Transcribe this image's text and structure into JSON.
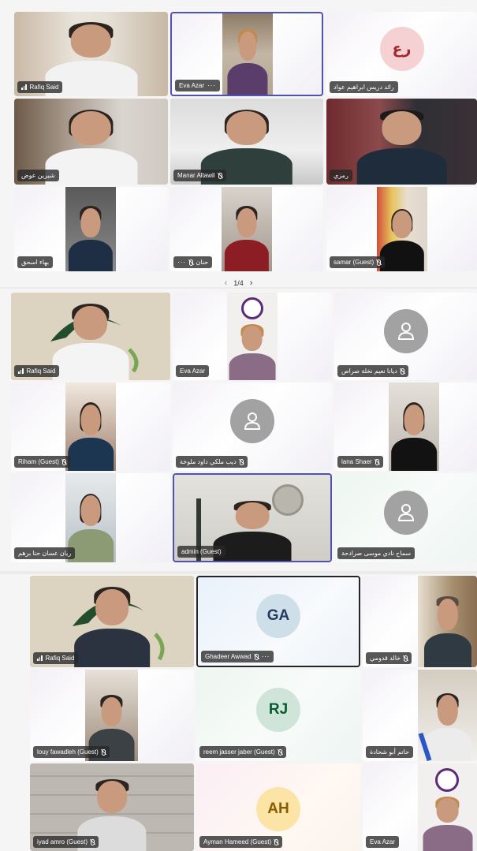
{
  "panel1": {
    "tiles": [
      {
        "name": "Rafiq Said"
      },
      {
        "name": "Eva Azar"
      },
      {
        "name": "رائد دريس ابراهيم عواد",
        "initials": "رع"
      },
      {
        "name": "شيرين عوض"
      },
      {
        "name": "Manar Altawil"
      },
      {
        "name": "رمزي"
      },
      {
        "name": "بهاء اسحق"
      },
      {
        "name": "حنان"
      },
      {
        "name": "samar (Guest)"
      }
    ],
    "pager": "1/4"
  },
  "panel2": {
    "tiles": [
      {
        "name": "Rafiq Said"
      },
      {
        "name": "Eva Azar"
      },
      {
        "name": "ديانا نعيم نخلة صراص"
      },
      {
        "name": "Riham (Guest)"
      },
      {
        "name": "ديب ملكي داود ملوخة"
      },
      {
        "name": "lana Shaer"
      },
      {
        "name": "ريان عسان حنا برهم"
      },
      {
        "name": "admin (Guest)"
      },
      {
        "name": "سماح نادي موسى صرادحة"
      }
    ]
  },
  "panel3": {
    "tiles": [
      {
        "name": "Rafiq Said"
      },
      {
        "name": "Ghadeer Awwad",
        "initials": "GA"
      },
      {
        "name": "خالد قدومي"
      },
      {
        "name": "louy fawadleh (Guest)"
      },
      {
        "name": "reem jasser jaber (Guest)",
        "initials": "RJ"
      },
      {
        "name": "حاتم أبو شحادة"
      },
      {
        "name": "iyad amro (Guest)"
      },
      {
        "name": "Ayman Hameed (Guest)",
        "initials": "AH"
      },
      {
        "name": "Eva Azar"
      }
    ]
  },
  "colors": {
    "accent": "#4f52b2",
    "initials_red_bg": "#f6d1d3",
    "initials_red_fg": "#a4262c",
    "initials_blue_bg": "#cfdfea",
    "initials_blue_fg": "#243a5e",
    "initials_green_bg": "#cfe5d9",
    "initials_green_fg": "#0b5a2f",
    "initials_yellow_bg": "#fbe4a6",
    "initials_yellow_fg": "#8a5c00"
  },
  "icons": [
    "mic-off-icon",
    "signal-bars-icon",
    "more-options-icon",
    "person-placeholder-icon",
    "chevron-left-icon",
    "chevron-right-icon"
  ]
}
